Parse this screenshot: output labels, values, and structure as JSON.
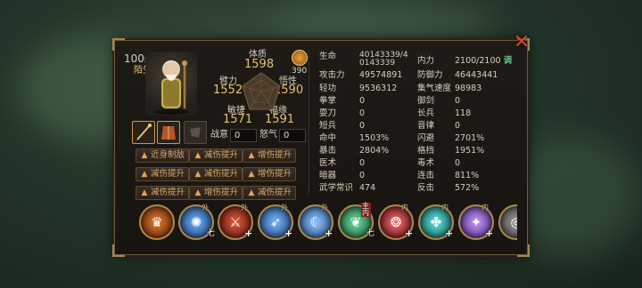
{
  "character": {
    "level": "100",
    "level_suffix": "级",
    "name": "陌生"
  },
  "attributes": {
    "tizhi": {
      "label": "体质",
      "value": "1598"
    },
    "bili": {
      "label": "臂力",
      "value": "1552"
    },
    "wuxing": {
      "label": "悟性",
      "value": "1590"
    },
    "minjie": {
      "label": "敏捷",
      "value": "1571"
    },
    "fuyuan": {
      "label": "福缘",
      "value": "1591"
    },
    "points": "390"
  },
  "fields": {
    "zhanyi": {
      "label": "战意",
      "value": "0"
    },
    "nuqi": {
      "label": "怒气",
      "value": "0"
    }
  },
  "passives": [
    [
      "近身制敌",
      "减伤提升",
      "增伤提升"
    ],
    [
      "减伤提升",
      "减伤提升",
      "增伤提升"
    ],
    [
      "减伤提升",
      "增伤提升",
      "减伤提升"
    ]
  ],
  "stats_left": [
    {
      "label": "生命",
      "value": "40143339/40143339"
    },
    {
      "label": "攻击力",
      "value": "49574891"
    },
    {
      "label": "轻功",
      "value": "9536312"
    },
    {
      "label": "拳掌",
      "value": "0"
    },
    {
      "label": "耍刀",
      "value": "0"
    },
    {
      "label": "短兵",
      "value": "0"
    },
    {
      "label": "命中",
      "value": "1503%"
    },
    {
      "label": "暴击",
      "value": "2804%"
    },
    {
      "label": "医术",
      "value": "0"
    },
    {
      "label": "暗器",
      "value": "0"
    },
    {
      "label": "武学常识",
      "value": "474"
    }
  ],
  "stats_right": [
    {
      "label": "内力",
      "value": "2100/2100",
      "extra": "调"
    },
    {
      "label": "防御力",
      "value": "46443441"
    },
    {
      "label": "集气速度",
      "value": "98983"
    },
    {
      "label": "御剑",
      "value": "0"
    },
    {
      "label": "长兵",
      "value": "118"
    },
    {
      "label": "音律",
      "value": "0"
    },
    {
      "label": "闪避",
      "value": "2701%"
    },
    {
      "label": "格挡",
      "value": "1951%"
    },
    {
      "label": "毒术",
      "value": "0"
    },
    {
      "label": "连击",
      "value": "811%"
    },
    {
      "label": "反击",
      "value": "572%"
    }
  ],
  "skills": [
    {
      "icon": "crown-flame-icon",
      "badge": "",
      "corner": "",
      "color": "#b8481e"
    },
    {
      "icon": "wind-swirl-icon",
      "badge": "外",
      "corner": "七",
      "color": "#2f6fc4"
    },
    {
      "icon": "crossed-blades-icon",
      "badge": "外",
      "corner": "+",
      "color": "#a0312a"
    },
    {
      "icon": "spear-thrust-icon",
      "badge": "外",
      "corner": "+",
      "color": "#3a7fd0"
    },
    {
      "icon": "moon-slash-icon",
      "badge": "外",
      "corner": "+",
      "color": "#4a8ad8"
    },
    {
      "icon": "bamboo-leaf-icon",
      "badge": "主内",
      "corner": "七",
      "color": "#2d8a5e"
    },
    {
      "icon": "demon-mouth-icon",
      "badge": "内",
      "corner": "+",
      "color": "#b22a3a"
    },
    {
      "icon": "spirit-orb-icon",
      "badge": "内",
      "corner": "+",
      "color": "#1f8f8a"
    },
    {
      "icon": "violet-slash-icon",
      "badge": "内",
      "corner": "+",
      "color": "#7b4fc8"
    },
    {
      "icon": "grey-seal-icon",
      "badge": "",
      "corner": "",
      "color": "#5a5a5a"
    }
  ]
}
